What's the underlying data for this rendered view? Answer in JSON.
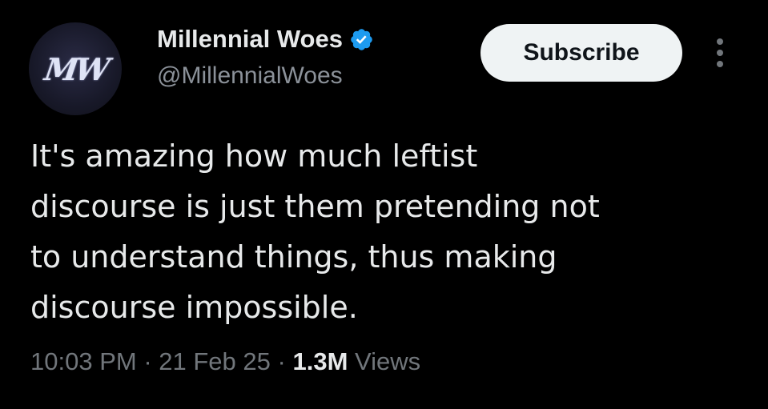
{
  "author": {
    "display_name": "Millennial Woes",
    "handle": "@MillennialWoes",
    "avatar_initials": "MW",
    "verified": true
  },
  "actions": {
    "subscribe_label": "Subscribe",
    "more_icon": "more-vertical-icon"
  },
  "tweet": {
    "lines": [
      "It's amazing how much leftist",
      "discourse is just them pretending not",
      "to understand things, thus making",
      "discourse impossible."
    ]
  },
  "meta": {
    "time": "10:03 PM",
    "separator": "·",
    "date": "21 Feb 25",
    "views_count": "1.3M",
    "views_label": "Views"
  },
  "colors": {
    "background": "#000000",
    "text_primary": "#e7e9ea",
    "text_secondary": "#71767b",
    "verified_badge": "#1d9bf0",
    "subscribe_bg": "#eff3f4"
  }
}
